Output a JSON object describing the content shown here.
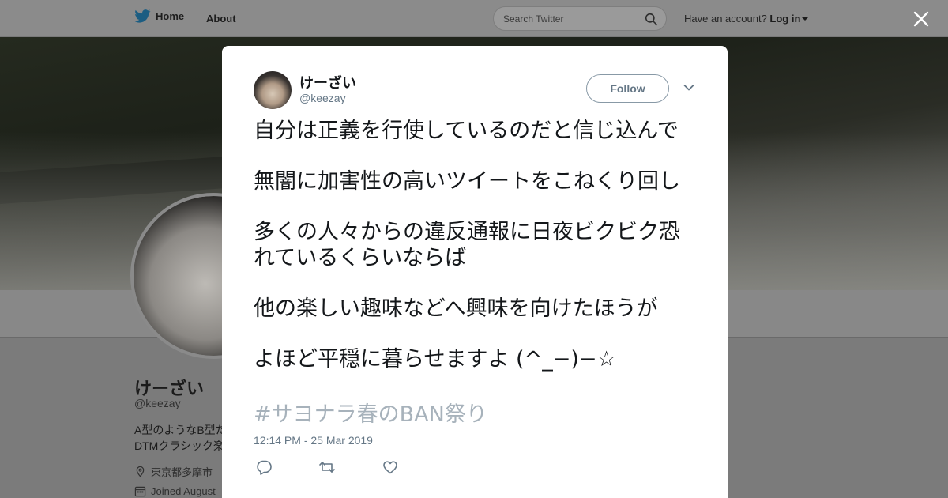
{
  "nav": {
    "home_label": "Home",
    "about_label": "About",
    "search_placeholder": "Search Twitter",
    "account_prompt": "Have an account?",
    "login_label": "Log in"
  },
  "profile": {
    "name": "けーざい",
    "handle": "@keezay",
    "bio_line1": "A型のようなB型た",
    "bio_line2": "DTMクラシック楽",
    "location": "東京都多摩市",
    "joined": "Joined August"
  },
  "tweet": {
    "author_name": "けーざい",
    "author_handle": "@keezay",
    "follow_label": "Follow",
    "lines": [
      "自分は正義を行使しているのだと信じ込んで",
      "無闇に加害性の高いツイートをこねくり回し",
      "多くの人々からの違反通報に日夜ビクビク恐",
      "れているくらいならば",
      "他の楽しい趣味などへ興味を向けたほうが",
      "よほど平穏に暮らせますよ (^_−)−☆"
    ],
    "hashtag": "#サヨナラ春のBAN祭り",
    "timestamp": "12:14 PM - 25 Mar 2019"
  },
  "icons": {
    "logo": "twitter-bird-icon",
    "search": "search-icon",
    "close": "close-icon",
    "menu": "chevron-down-icon",
    "reply": "reply-icon",
    "retweet": "retweet-icon",
    "like": "heart-icon",
    "location": "location-pin-icon",
    "calendar": "calendar-icon"
  },
  "colors": {
    "brand": "#1da1f2",
    "text": "#14171a",
    "muted": "#657786",
    "hashtag_faded": "#a7b2bb"
  }
}
